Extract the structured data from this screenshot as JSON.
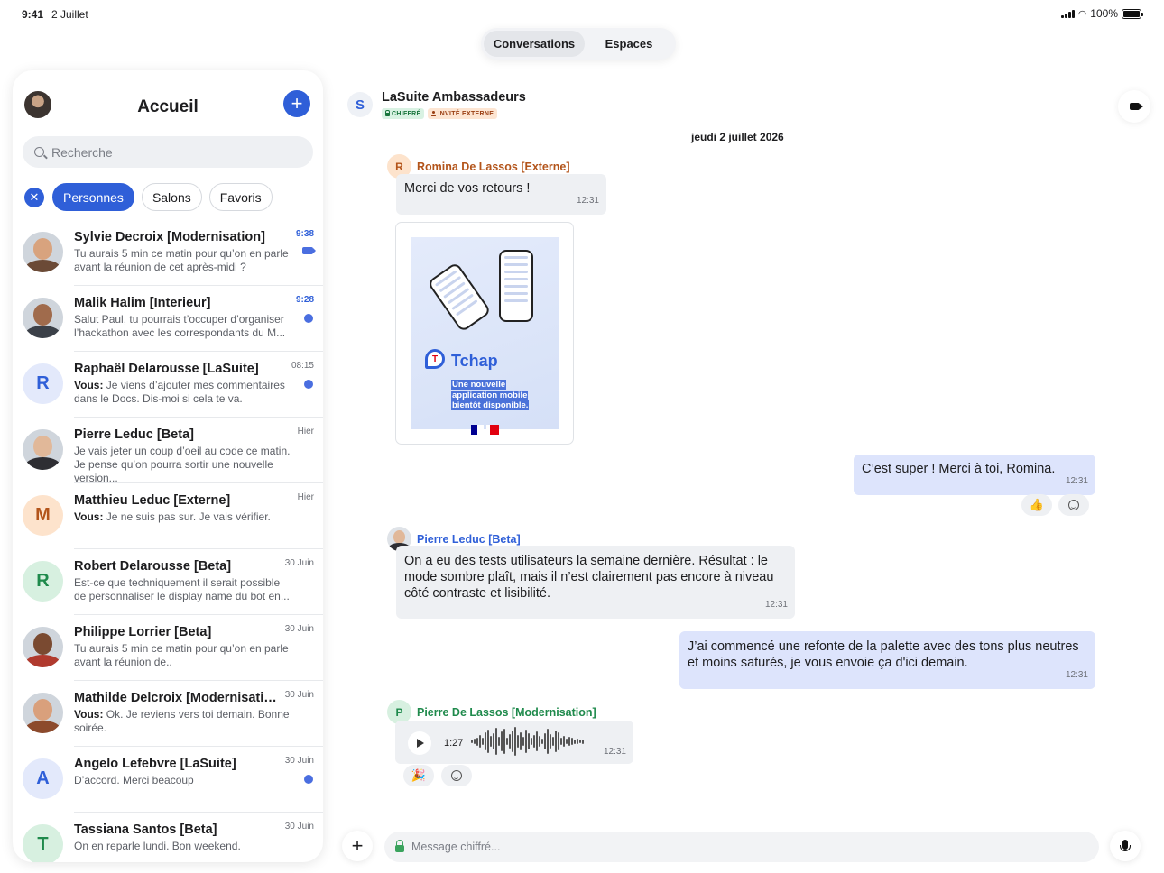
{
  "status_bar": {
    "time": "9:41",
    "date": "2 Juillet",
    "battery": "100%"
  },
  "top_tabs": [
    {
      "label": "Conversations",
      "active": true
    },
    {
      "label": "Espaces",
      "active": false
    }
  ],
  "sidebar": {
    "title": "Accueil",
    "search_placeholder": "Recherche",
    "filters": [
      {
        "label": "Personnes",
        "active": true
      },
      {
        "label": "Salons",
        "active": false
      },
      {
        "label": "Favoris",
        "active": false
      }
    ],
    "conversations": [
      {
        "name": "Sylvie Decroix [Modernisation]",
        "time": "9:38",
        "time_unread": true,
        "prefix": "",
        "preview": "Tu aurais 5 min ce matin pour qu’on en parle avant la réunion de cet après-midi ?",
        "indicator": "video-icon",
        "avatar": "photo",
        "skin": "#d8a37e",
        "cloth": "#6b4a36"
      },
      {
        "name": "Malik Halim [Interieur]",
        "time": "9:28",
        "time_unread": true,
        "prefix": "",
        "preview": "Salut Paul, tu pourrais t’occuper d’organiser l’hackathon avec les correspondants du M...",
        "indicator": "unread-dot",
        "avatar": "photo",
        "skin": "#a06b4c",
        "cloth": "#3b4048"
      },
      {
        "name": "Raphaël Delarousse [LaSuite]",
        "time": "08:15",
        "time_unread": false,
        "prefix": "Vous:",
        "preview": " Je viens d’ajouter mes commentaires dans le Docs. Dis-moi si cela te va.",
        "indicator": "unread-dot",
        "avatar": "R",
        "avatar_bg": "#e3e9fb",
        "avatar_fg": "#2f5fd8"
      },
      {
        "name": "Pierre Leduc [Beta]",
        "time": "Hier",
        "time_unread": false,
        "prefix": "",
        "preview": "Je vais jeter un coup d’oeil au code ce matin. Je pense qu’on pourra sortir une nouvelle version...",
        "indicator": "",
        "avatar": "photo",
        "skin": "#e1b899",
        "cloth": "#2e2e33"
      },
      {
        "name": "Matthieu Leduc [Externe]",
        "time": "Hier",
        "time_unread": false,
        "prefix": "Vous:",
        "preview": " Je ne suis pas sur. Je vais vérifier.",
        "indicator": "",
        "avatar": "M",
        "avatar_bg": "#fde3cc",
        "avatar_fg": "#b3541a"
      },
      {
        "name": "Robert Delarousse [Beta]",
        "time": "30 Juin",
        "time_unread": false,
        "prefix": "",
        "preview": "Est-ce que techniquement il serait possible de personnaliser le display name du bot en...",
        "indicator": "",
        "avatar": "R",
        "avatar_bg": "#d7f0e0",
        "avatar_fg": "#1f8a4c"
      },
      {
        "name": "Philippe Lorrier [Beta]",
        "time": "30 Juin",
        "time_unread": false,
        "prefix": "",
        "preview": "Tu aurais 5 min ce matin pour qu’on en parle avant la réunion de..",
        "indicator": "",
        "avatar": "photo",
        "skin": "#7a4a31",
        "cloth": "#b03a2e"
      },
      {
        "name": "Mathilde Delcroix [Modernisation]",
        "time": "30 Juin",
        "time_unread": false,
        "prefix": "Vous:",
        "preview": " Ok. Je reviens vers toi demain. Bonne soirée.",
        "indicator": "",
        "avatar": "photo",
        "skin": "#d9a07c",
        "cloth": "#8c4a2c"
      },
      {
        "name": "Angelo Lefebvre [LaSuite]",
        "time": "30 Juin",
        "time_unread": false,
        "prefix": "",
        "preview": "D’accord. Merci beacoup",
        "indicator": "unread-dot",
        "avatar": "A",
        "avatar_bg": "#e3e9fb",
        "avatar_fg": "#2f5fd8"
      },
      {
        "name": "Tassiana Santos [Beta]",
        "time": "30 Juin",
        "time_unread": false,
        "prefix": "",
        "preview": "On en reparle lundi. Bon weekend.",
        "indicator": "",
        "avatar": "T",
        "avatar_bg": "#d7f0e0",
        "avatar_fg": "#1f8a4c"
      }
    ]
  },
  "room": {
    "name": "LaSuite Ambassadeurs",
    "badges": [
      {
        "label": "CHIFFRÉ",
        "icon": "lock-icon"
      },
      {
        "label": "INVITÉ EXTERNE",
        "icon": "person-icon"
      }
    ],
    "date": "jeudi 2 juillet 2026",
    "messages": {
      "m1": {
        "sender": "Romina De Lassos [Externe]",
        "initial": "R",
        "text": "Merci de vos retours !",
        "time": "12:31"
      },
      "image": {
        "app_name": "Tchap",
        "lines": [
          "Une nouvelle",
          "application mobile",
          "bientôt disponible."
        ]
      },
      "m2": {
        "text": "C’est super ! Merci à toi, Romina.",
        "time": "12:31",
        "reaction": "👍"
      },
      "m3": {
        "sender": "Pierre Leduc [Beta]",
        "text": "On a eu des tests utilisateurs la semaine dernière. Résultat : le mode sombre plaît, mais il n’est clairement pas encore à niveau côté contraste et lisibilité.",
        "time": "12:31"
      },
      "m4": {
        "text": "J’ai commencé une refonte de la palette avec des tons plus neutres et moins saturés, je vous envoie ça d'ici demain.",
        "time": "12:31"
      },
      "m5": {
        "sender": "Pierre De Lassos [Modernisation]",
        "initial": "P",
        "duration": "1:27",
        "time": "12:31",
        "reaction": "🎉"
      }
    }
  },
  "composer": {
    "placeholder": "Message chiffré..."
  },
  "colors": {
    "accent": "#2f5fd8",
    "mine_bubble": "#dde4fc",
    "other_bubble": "#eef0f3",
    "romina": "#b3541a",
    "pierre_leduc": "#2f5fd8",
    "pierre_de_lassos": "#1f8a4c"
  }
}
